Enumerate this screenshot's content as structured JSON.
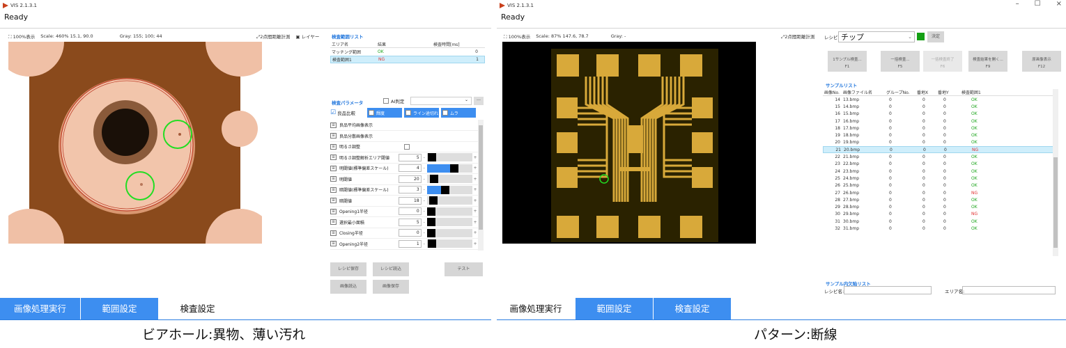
{
  "windowA": {
    "title": "VIS 2.1.3.1",
    "status": "Ready",
    "toolbar": {
      "zoom": "100%表示",
      "scale": "Scale: 460% 15.1, 90.0",
      "gray": "Gray: 155; 100; 44",
      "measure": "2点間距離計測",
      "layer": "レイヤー"
    },
    "area_list": {
      "title": "検査範囲リスト",
      "headers": [
        "エリア名",
        "結果",
        "検査時間[ms]"
      ],
      "rows": [
        {
          "name": "マッチング範囲",
          "result": "OK",
          "time": "0"
        },
        {
          "name": "検査範囲1",
          "result": "NG",
          "time": "1"
        }
      ]
    },
    "params": {
      "title": "検査パラメータ",
      "ai_label": "AI判定",
      "modes": [
        "良品比較",
        "輝度",
        "ライン途切れ",
        "ムラ"
      ],
      "items": [
        {
          "label": "良品平均画像表示",
          "value": "",
          "fill": null,
          "thumb": null
        },
        {
          "label": "良品分散画像表示",
          "value": "",
          "fill": null,
          "thumb": null
        },
        {
          "label": "明るさ調整",
          "value": "",
          "fill": null,
          "thumb": null
        },
        {
          "label": "明るさ調整解析エリア閾値",
          "value": "5",
          "fill": 0,
          "thumb": 0.02
        },
        {
          "label": "明閾値(標準偏差スケール)",
          "value": "4",
          "fill": 0.62,
          "thumb": 0.62
        },
        {
          "label": "明閾値",
          "value": "20",
          "fill": 0,
          "thumb": 0.08
        },
        {
          "label": "暗閾値(標準偏差スケール)",
          "value": "3",
          "fill": 0.38,
          "thumb": 0.38
        },
        {
          "label": "暗閾値",
          "value": "18",
          "fill": 0,
          "thumb": 0.07
        },
        {
          "label": "Opening1半径",
          "value": "0",
          "fill": 0,
          "thumb": 0
        },
        {
          "label": "選択最小面積",
          "value": "5",
          "fill": 0,
          "thumb": 0
        },
        {
          "label": "Closing半径",
          "value": "0",
          "fill": 0,
          "thumb": 0
        },
        {
          "label": "Opening2半径",
          "value": "1",
          "fill": 0,
          "thumb": 0.02
        }
      ]
    },
    "buttons": {
      "save_recipe": "レシピ保存",
      "load_recipe": "レシピ読込",
      "test": "テスト",
      "load_image": "画像読込",
      "save_image": "画像保存"
    },
    "tabs": [
      "画像処理実行",
      "範囲設定",
      "検査設定"
    ],
    "active_tab": 2
  },
  "windowB": {
    "title": "VIS 2.1.3.1",
    "status": "Ready",
    "toolbar": {
      "zoom": "100%表示",
      "scale": "Scale: 87% 147.6, 78.7",
      "gray": "Gray: -",
      "measure": "2点間距離計測"
    },
    "recipe": {
      "label": "レシピ",
      "value": "チップ",
      "decide": "決定"
    },
    "fkeys": [
      {
        "label": "1サンプル検査...",
        "key": "F1",
        "disabled": false
      },
      {
        "label": "一括検査...",
        "key": "F5",
        "disabled": false
      },
      {
        "label": "一括検査終了",
        "key": "F6",
        "disabled": true
      },
      {
        "label": "検査結果を開く...",
        "key": "F9",
        "disabled": false
      },
      {
        "label": "原画像表示",
        "key": "F12",
        "disabled": false
      }
    ],
    "sample_list": {
      "title": "サンプルリスト",
      "headers": [
        "画像No.",
        "画像ファイル名",
        "グループNo.",
        "番地X",
        "番地Y",
        "検査範囲1"
      ],
      "rows": [
        {
          "no": "14",
          "file": "13.bmp",
          "group": "0",
          "x": "0",
          "y": "0",
          "result": "OK"
        },
        {
          "no": "15",
          "file": "14.bmp",
          "group": "0",
          "x": "0",
          "y": "0",
          "result": "OK"
        },
        {
          "no": "16",
          "file": "15.bmp",
          "group": "0",
          "x": "0",
          "y": "0",
          "result": "OK"
        },
        {
          "no": "17",
          "file": "16.bmp",
          "group": "0",
          "x": "0",
          "y": "0",
          "result": "OK"
        },
        {
          "no": "18",
          "file": "17.bmp",
          "group": "0",
          "x": "0",
          "y": "0",
          "result": "OK"
        },
        {
          "no": "19",
          "file": "18.bmp",
          "group": "0",
          "x": "0",
          "y": "0",
          "result": "OK"
        },
        {
          "no": "20",
          "file": "19.bmp",
          "group": "0",
          "x": "0",
          "y": "0",
          "result": "OK"
        },
        {
          "no": "21",
          "file": "20.bmp",
          "group": "0",
          "x": "0",
          "y": "0",
          "result": "NG"
        },
        {
          "no": "22",
          "file": "21.bmp",
          "group": "0",
          "x": "0",
          "y": "0",
          "result": "OK"
        },
        {
          "no": "23",
          "file": "22.bmp",
          "group": "0",
          "x": "0",
          "y": "0",
          "result": "OK"
        },
        {
          "no": "24",
          "file": "23.bmp",
          "group": "0",
          "x": "0",
          "y": "0",
          "result": "OK"
        },
        {
          "no": "25",
          "file": "24.bmp",
          "group": "0",
          "x": "0",
          "y": "0",
          "result": "OK"
        },
        {
          "no": "26",
          "file": "25.bmp",
          "group": "0",
          "x": "0",
          "y": "0",
          "result": "OK"
        },
        {
          "no": "27",
          "file": "26.bmp",
          "group": "0",
          "x": "0",
          "y": "0",
          "result": "NG"
        },
        {
          "no": "28",
          "file": "27.bmp",
          "group": "0",
          "x": "0",
          "y": "0",
          "result": "OK"
        },
        {
          "no": "29",
          "file": "28.bmp",
          "group": "0",
          "x": "0",
          "y": "0",
          "result": "OK"
        },
        {
          "no": "30",
          "file": "29.bmp",
          "group": "0",
          "x": "0",
          "y": "0",
          "result": "NG"
        },
        {
          "no": "31",
          "file": "30.bmp",
          "group": "0",
          "x": "0",
          "y": "0",
          "result": "OK"
        },
        {
          "no": "32",
          "file": "31.bmp",
          "group": "0",
          "x": "0",
          "y": "0",
          "result": "OK"
        }
      ],
      "selected_index": 7
    },
    "defect_list": {
      "title": "サンプル内欠陥リスト",
      "recipe_label": "レシピ名:",
      "area_label": "エリア名:"
    },
    "tabs": [
      "画像処理実行",
      "範囲設定",
      "検査設定"
    ],
    "active_tab": 0
  },
  "captions": {
    "left": "ビアホール:異物、薄い汚れ",
    "right": "パターン:断線"
  },
  "colors": {
    "accent": "#3d8ef0",
    "ok": "#1aa41a",
    "ng": "#e03030",
    "select": "#cfeefb",
    "copper": "#e9b98f",
    "via_ring": "#f4c4a8",
    "chip_gold": "#d8a93a"
  }
}
